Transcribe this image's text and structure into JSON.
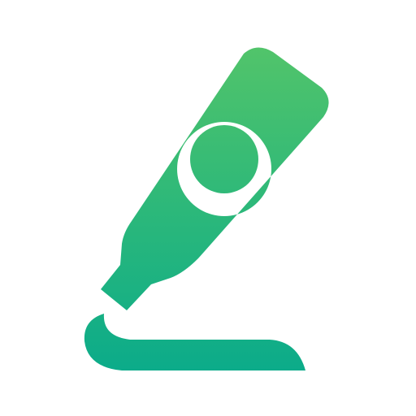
{
  "icon": {
    "name": "marker-pen-icon",
    "colors": {
      "gradient_top": "#52c46a",
      "gradient_mid": "#2cb87a",
      "gradient_bottom": "#0bab8a",
      "background": "#ffffff"
    }
  }
}
